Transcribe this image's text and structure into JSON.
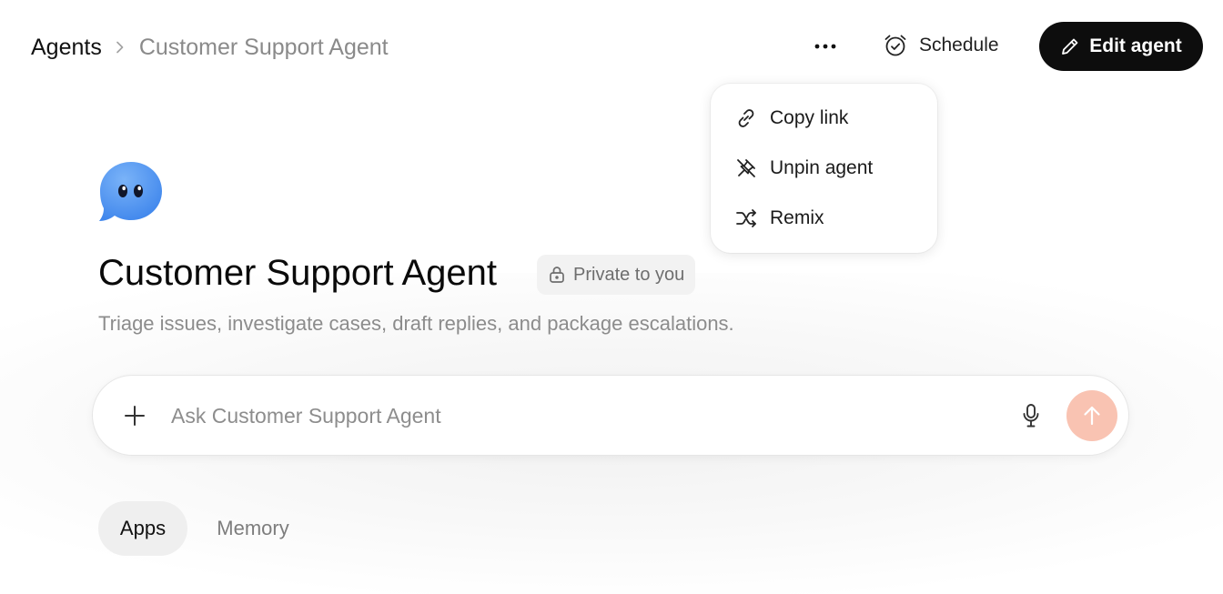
{
  "breadcrumb": {
    "root": "Agents",
    "current": "Customer Support Agent"
  },
  "header": {
    "more_label": "···",
    "schedule_label": "Schedule",
    "edit_label": "Edit agent"
  },
  "menu": {
    "items": [
      {
        "label": "Copy link",
        "icon": "link-icon"
      },
      {
        "label": "Unpin agent",
        "icon": "unpin-icon"
      },
      {
        "label": "Remix",
        "icon": "shuffle-icon"
      }
    ]
  },
  "agent": {
    "name": "Customer Support Agent",
    "badge": "Private to you",
    "description": "Triage issues, investigate cases, draft replies, and package escalations.",
    "avatar_color": "#4f93ee"
  },
  "composer": {
    "placeholder": "Ask Customer Support Agent",
    "value": "",
    "send_color": "#f9c3b2"
  },
  "tabs": [
    {
      "label": "Apps",
      "selected": true
    },
    {
      "label": "Memory",
      "selected": false
    }
  ]
}
